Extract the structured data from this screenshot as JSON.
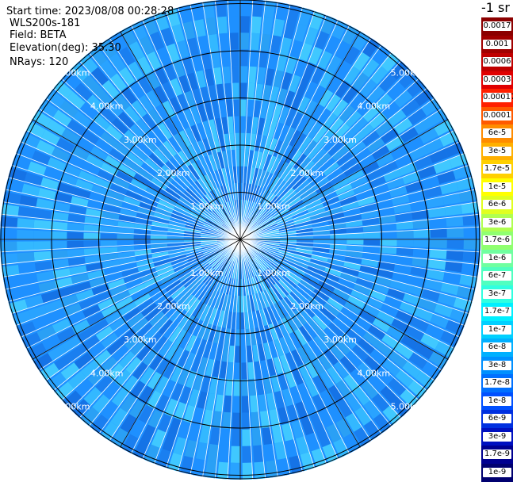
{
  "header": {
    "start_time": "Start time: 2023/08/08 00:28:28",
    "instrument": "WLS200s-181",
    "field": "Field: BETA",
    "elevation": "Elevation(deg): 35.30",
    "nrays": "NRays: 120"
  },
  "colorbar": {
    "unit_label": "-1 sr",
    "labels": [
      "0.0017",
      "0.001",
      "0.0006",
      "0.0003",
      "0.00017",
      "0.0001",
      "6e-5",
      "3e-5",
      "1.7e-5",
      "1e-5",
      "6e-6",
      "3e-6",
      "1.7e-6",
      "1e-6",
      "6e-7",
      "3e-7",
      "1.7e-7",
      "1e-7",
      "6e-8",
      "3e-8",
      "1.7e-8",
      "1e-8",
      "6e-9",
      "3e-9",
      "1.7e-9",
      "1e-9"
    ],
    "colors": [
      "#8b0000",
      "#a00000",
      "#c00000",
      "#e00000",
      "#ff2000",
      "#ff5a00",
      "#ff8c00",
      "#ffb000",
      "#ffd000",
      "#ffff00",
      "#e0ff20",
      "#b0ff50",
      "#90ff70",
      "#70ffa0",
      "#50ffc0",
      "#30ffe0",
      "#00f0ff",
      "#00d0ff",
      "#00b0ff",
      "#0090ff",
      "#0070ff",
      "#0050ff",
      "#0030e0",
      "#0010c0",
      "#000090",
      "#000070"
    ]
  },
  "range_rings": {
    "labels": [
      "1.00km",
      "2.00km",
      "3.00km",
      "4.00km",
      "5.00km"
    ]
  },
  "colors": {
    "background": "#ffffff",
    "grid": "#000000",
    "plot_base": "#1e90ff"
  }
}
